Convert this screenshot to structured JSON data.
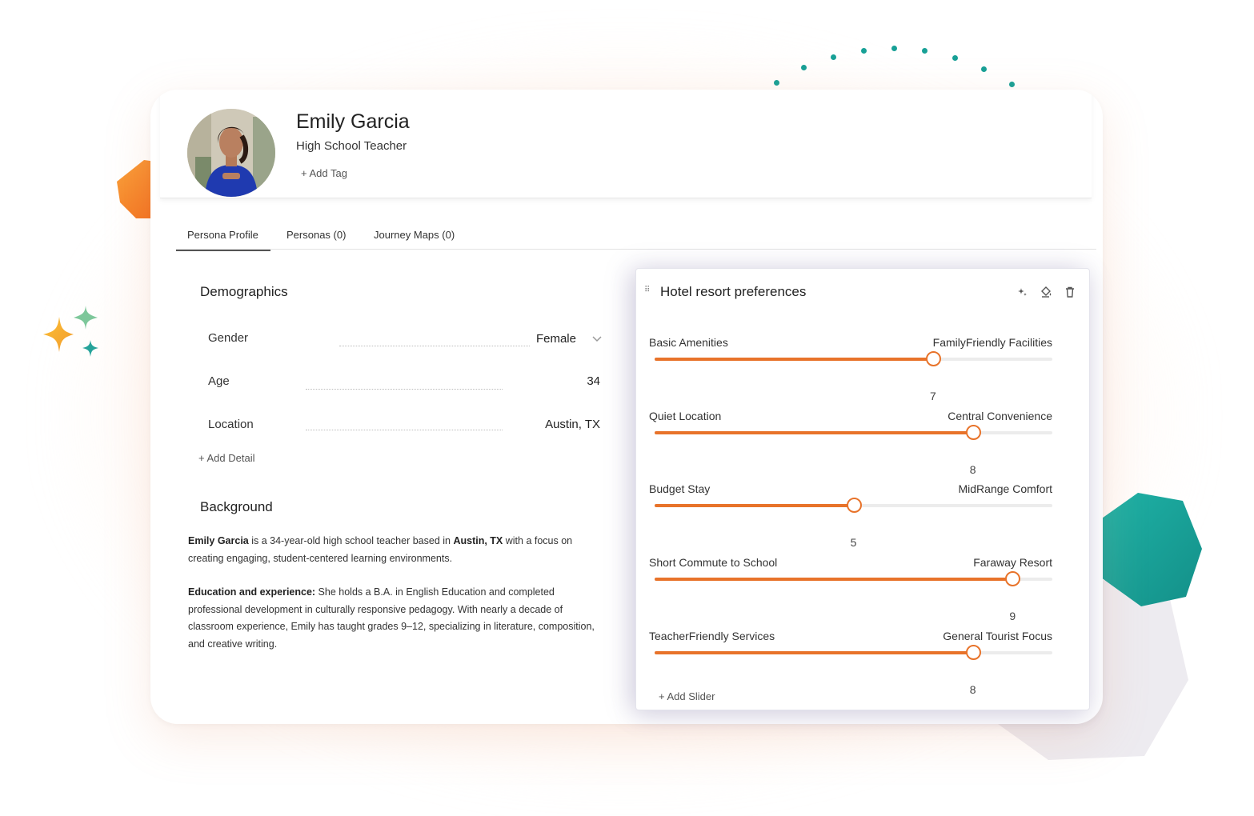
{
  "profile": {
    "name": "Emily Garcia",
    "role": "High School Teacher",
    "add_tag": "+ Add Tag"
  },
  "tabs": [
    {
      "label": "Persona Profile",
      "active": true
    },
    {
      "label": "Personas (0)",
      "active": false
    },
    {
      "label": "Journey Maps (0)",
      "active": false
    }
  ],
  "demographics": {
    "title": "Demographics",
    "fields": [
      {
        "label": "Gender",
        "value": "Female"
      },
      {
        "label": "Age",
        "value": "34"
      },
      {
        "label": "Location",
        "value": "Austin, TX"
      }
    ],
    "add_detail": "+ Add Detail"
  },
  "background": {
    "title": "Background",
    "p1": {
      "name": "Emily Garcia",
      "text1": " is a 34-year-old high school teacher based in ",
      "city": "Austin, TX",
      "text2": " with a focus on creating engaging, student-centered learning environments."
    },
    "p2": {
      "heading": "Education and experience:",
      "text": " She holds a B.A. in English Education and completed professional development in culturally responsive pedagogy. With nearly a decade of classroom experience, Emily has taught grades 9–12, specializing in literature, composition, and creative writing."
    }
  },
  "panel": {
    "title": "Hotel resort preferences",
    "icons": [
      "sparkle-icon",
      "paint-bucket-icon",
      "trash-icon"
    ],
    "sliders": [
      {
        "left": "Basic Amenities",
        "right": "FamilyFriendly Facilities",
        "value": 7,
        "max": 10
      },
      {
        "left": "Quiet Location",
        "right": "Central Convenience",
        "value": 8,
        "max": 10
      },
      {
        "left": "Budget Stay",
        "right": "MidRange Comfort",
        "value": 5,
        "max": 10
      },
      {
        "left": "Short Commute to School",
        "right": "Faraway Resort",
        "value": 9,
        "max": 10
      },
      {
        "left": "TeacherFriendly Services",
        "right": "General Tourist Focus",
        "value": 8,
        "max": 10
      }
    ],
    "add_slider": "+ Add Slider"
  },
  "colors": {
    "accent": "#e8732a",
    "teal": "#17a096",
    "orange_blob": "#f47b20"
  }
}
